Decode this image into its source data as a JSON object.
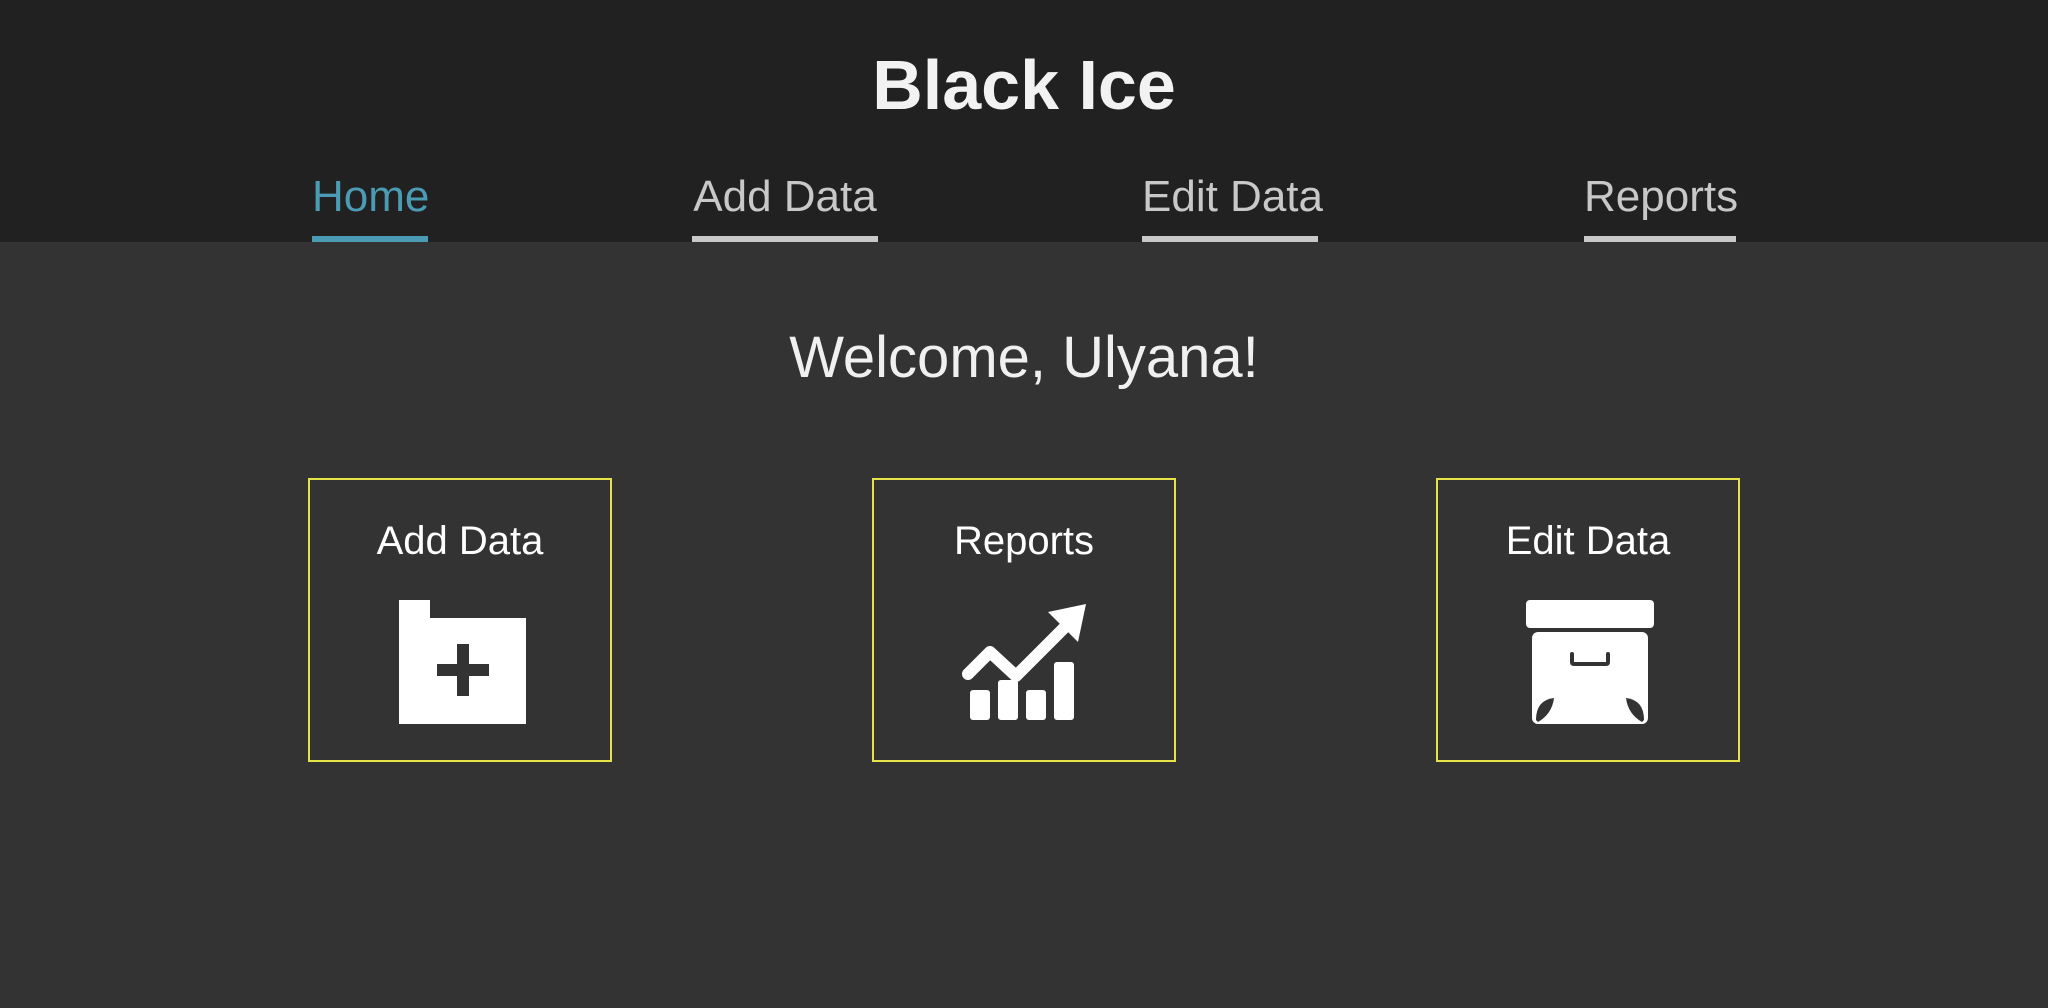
{
  "header": {
    "title": "Black Ice",
    "tabs": [
      {
        "label": "Home",
        "active": true
      },
      {
        "label": "Add Data",
        "active": false
      },
      {
        "label": "Edit Data",
        "active": false
      },
      {
        "label": "Reports",
        "active": false
      }
    ]
  },
  "main": {
    "welcome": "Welcome, Ulyana!",
    "cards": [
      {
        "label": "Add Data",
        "icon": "folder-plus-icon"
      },
      {
        "label": "Reports",
        "icon": "chart-trend-up-icon"
      },
      {
        "label": "Edit Data",
        "icon": "archive-box-icon"
      }
    ]
  },
  "colors": {
    "header_bg": "#212121",
    "body_bg": "#333333",
    "accent": "#4a9bb3",
    "card_border": "#e6e34a",
    "tab_inactive": "#c8c8c8"
  }
}
